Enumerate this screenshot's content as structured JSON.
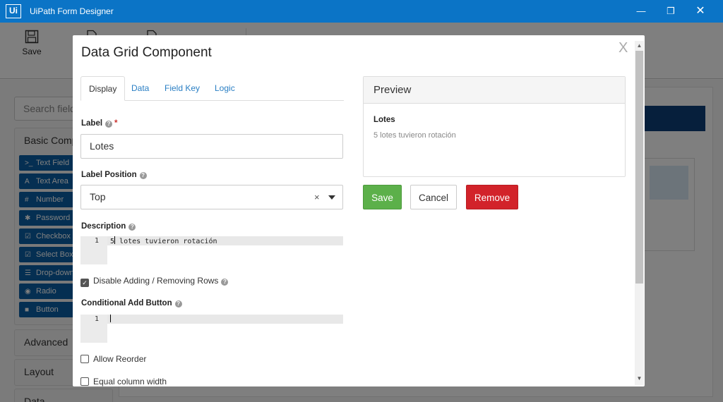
{
  "titlebar": {
    "logo": "Ui",
    "title": "UiPath Form Designer",
    "minimize": "—",
    "maximize": "❐",
    "close": "✕"
  },
  "ribbon": {
    "save_label": "Save"
  },
  "builder": {
    "search_placeholder": "Search field",
    "basic_panel": "Basic Comp",
    "components": [
      {
        "icon": ">_",
        "label": "Text Field"
      },
      {
        "icon": "A",
        "label": "Text Area"
      },
      {
        "icon": "#",
        "label": "Number"
      },
      {
        "icon": "✱",
        "label": "Password"
      },
      {
        "icon": "☑",
        "label": "Checkbox"
      },
      {
        "icon": "☑",
        "label": "Select Boxes"
      },
      {
        "icon": "☰",
        "label": "Drop-down"
      },
      {
        "icon": "◉",
        "label": "Radio"
      },
      {
        "icon": "■",
        "label": "Button"
      }
    ],
    "advanced_panel": "Advanced",
    "layout_panel": "Layout",
    "data_panel": "Data"
  },
  "modal": {
    "title": "Data Grid Component",
    "close": "X",
    "tabs": [
      {
        "label": "Display"
      },
      {
        "label": "Data"
      },
      {
        "label": "Field Key"
      },
      {
        "label": "Logic"
      }
    ],
    "label_field": {
      "label": "Label",
      "required": "*",
      "value": "Lotes"
    },
    "label_position": {
      "label": "Label Position",
      "value": "Top",
      "clear": "×"
    },
    "description": {
      "label": "Description",
      "line_no": "1",
      "first_char": "5",
      "text_rest": " lotes tuvieron rotación"
    },
    "disable_adding": {
      "label": "Disable Adding / Removing Rows",
      "checked": true
    },
    "conditional_add": {
      "label": "Conditional Add Button",
      "line_no": "1"
    },
    "allow_reorder": {
      "label": "Allow Reorder",
      "checked": false
    },
    "equal_width": {
      "label": "Equal column width",
      "checked": false
    },
    "help_glyph": "?",
    "check_glyph": "✓"
  },
  "preview": {
    "heading": "Preview",
    "label": "Lotes",
    "description": "5 lotes tuvieron rotación"
  },
  "actions": {
    "save": "Save",
    "cancel": "Cancel",
    "remove": "Remove"
  },
  "colors": {
    "titlebar": "#0b74c6",
    "component_button": "#0b5fa5",
    "save_button": "#5cb04a",
    "remove_button": "#d2232a",
    "link": "#2a7fc4"
  }
}
